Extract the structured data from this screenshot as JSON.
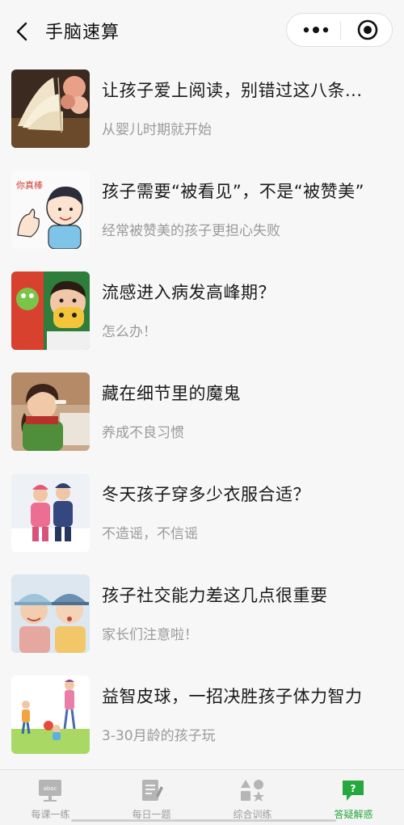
{
  "navbar": {
    "title": "手脑速算"
  },
  "articles": [
    {
      "title": "让孩子爱上阅读，别错过这八条...",
      "subtitle": "从婴儿时期就开始",
      "thumbnail": "open-book-with-roses"
    },
    {
      "title": "孩子需要“被看见”，不是“被赞美”",
      "subtitle": "经常被赞美的孩子更担心失败",
      "thumbnail": "cartoon-boy-thumbs-up",
      "thumb_caption": "你真棒"
    },
    {
      "title": "流感进入病发高峰期？",
      "subtitle": "怎么办！",
      "thumbnail": "child-with-mask"
    },
    {
      "title": "藏在细节里的魔鬼",
      "subtitle": "养成不良习惯",
      "thumbnail": "girl-eating"
    },
    {
      "title": "冬天孩子穿多少衣服合适？",
      "subtitle": "不造谣，不信谣",
      "thumbnail": "kids-in-snow"
    },
    {
      "title": "孩子社交能力差这几点很重要",
      "subtitle": "家长们注意啦！",
      "thumbnail": "two-kids-with-hats"
    },
    {
      "title": "益智皮球，一招决胜孩子体力智力",
      "subtitle": "3-30月龄的孩子玩",
      "thumbnail": "family-playing-ball"
    }
  ],
  "tabbar": {
    "tabs": [
      {
        "label": "每课一练",
        "icon": "abacus-board-icon",
        "active": false
      },
      {
        "label": "每日一题",
        "icon": "notepad-pencil-icon",
        "active": false
      },
      {
        "label": "综合训练",
        "icon": "shapes-icon",
        "active": false
      },
      {
        "label": "答疑解惑",
        "icon": "question-bubble-icon",
        "active": true
      }
    ],
    "abacus_text": "abac"
  },
  "colors": {
    "accent": "#25a83d",
    "inactive": "#9c9c9c",
    "background": "#f7f7f7"
  }
}
